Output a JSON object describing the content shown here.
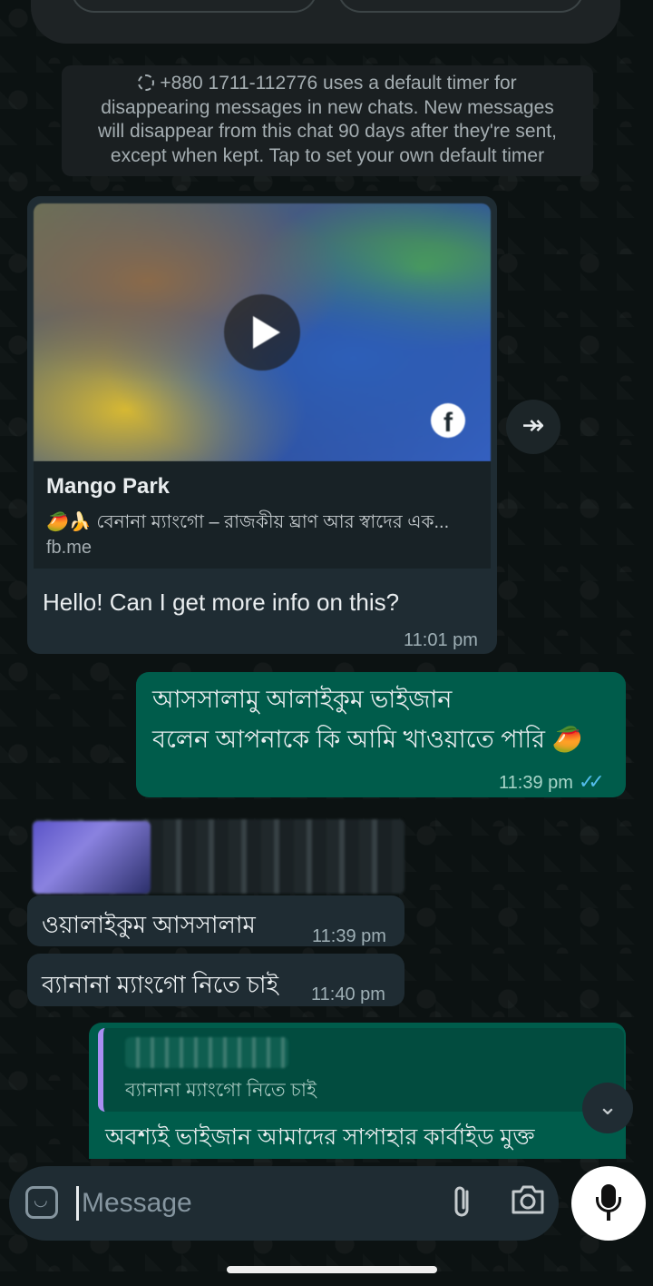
{
  "system_notice": {
    "text_line1": "+880 1711-112776 uses a default timer for",
    "text_line2": "disappearing messages in new chats. New messages",
    "text_line3": "will disappear from this chat 90 days after they're sent,",
    "text_line4": "except when kept. Tap to set your own default timer"
  },
  "link_preview": {
    "title": "Mango Park",
    "description": "🥭🍌 বেনানা ম্যাংগো – রাজকীয় ঘ্রাণ আর স্বাদের এক...",
    "host": "fb.me"
  },
  "messages": [
    {
      "direction": "in",
      "text": "Hello! Can I get more info on this?",
      "time": "11:01 pm"
    },
    {
      "direction": "out",
      "line1": "আসসালামু আলাইকুম ভাইজান",
      "line2": "বলেন আপনাকে কি আমি খাওয়াতে পারি 🥭",
      "time": "11:39 pm"
    },
    {
      "direction": "in",
      "text": "ওয়ালাইকুম আসসালাম",
      "time": "11:39 pm"
    },
    {
      "direction": "in",
      "text": "ব্যানানা ম্যাংগো নিতে চাই",
      "time": "11:40 pm"
    },
    {
      "direction": "out",
      "quote": "ব্যানানা ম্যাংগো নিতে চাই",
      "text": "অবশ্যই ভাইজান আমাদের সাপাহার কার্বাইড মুক্ত"
    }
  ],
  "input": {
    "placeholder": "Message"
  },
  "colors": {
    "incoming_bubble": "#1f2c33",
    "outgoing_bubble": "#005c4b",
    "read_ticks": "#53bdeb"
  }
}
